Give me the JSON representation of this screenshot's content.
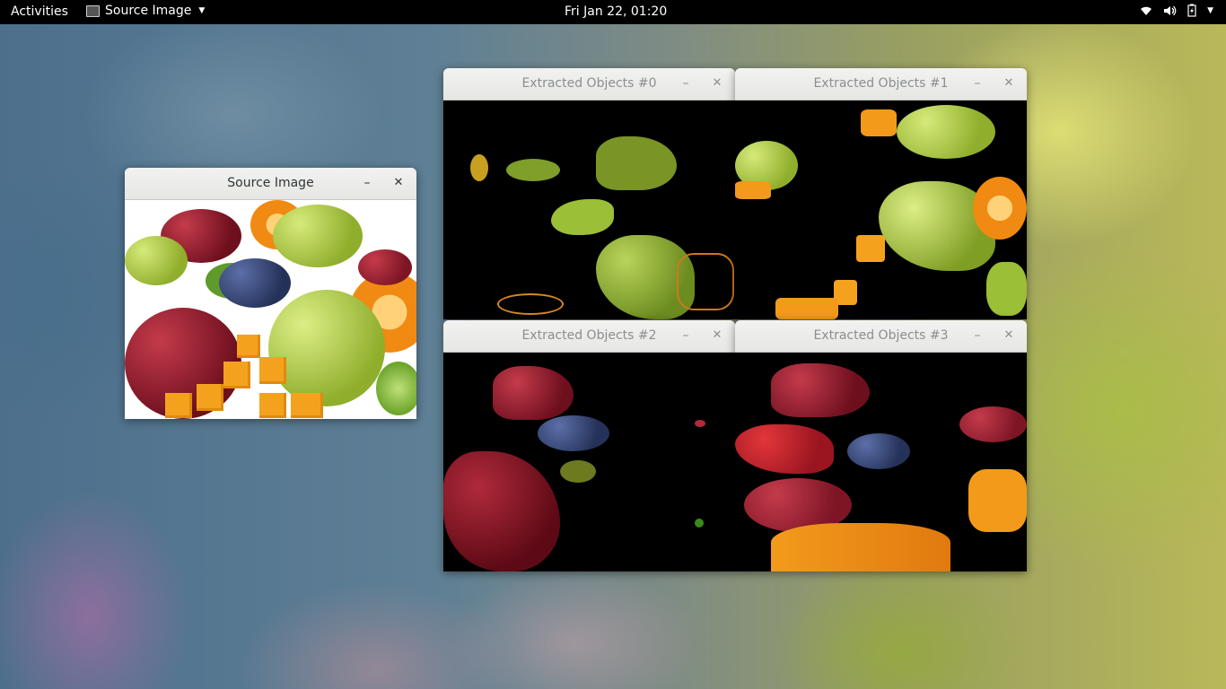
{
  "topbar": {
    "activities_label": "Activities",
    "app_menu_label": "Source Image",
    "clock": "Fri Jan 22, 01:20",
    "tray_icons": [
      "wifi-icon",
      "volume-icon",
      "battery-icon"
    ]
  },
  "windows": {
    "source": {
      "title": "Source Image"
    },
    "extracted0": {
      "title": "Extracted Objects #0"
    },
    "extracted1": {
      "title": "Extracted Objects #1"
    },
    "extracted2": {
      "title": "Extracted Objects #2"
    },
    "extracted3": {
      "title": "Extracted Objects #3"
    }
  },
  "window_controls": {
    "minimize_glyph": "–",
    "close_glyph": "✕"
  },
  "colors": {
    "grape_red": "#9b1b2a",
    "grape_green": "#a9c93a",
    "blueberry": "#3b4a7a",
    "orange": "#f39a1b",
    "cheese": "#f4a21e"
  }
}
